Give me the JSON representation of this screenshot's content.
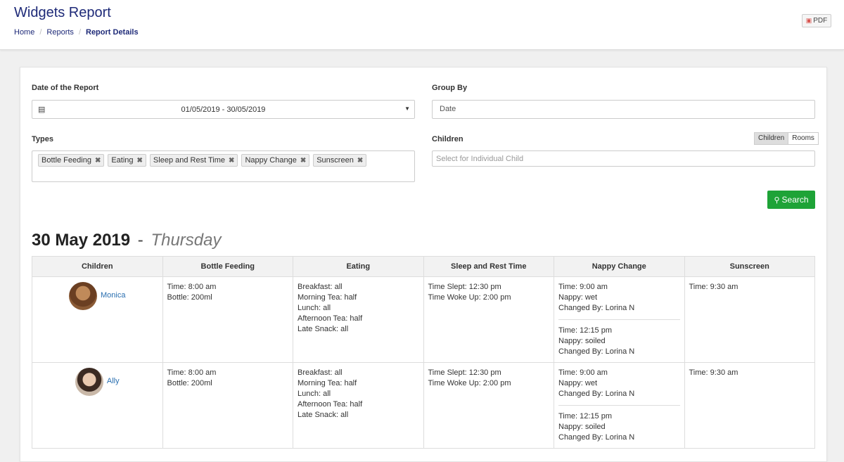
{
  "header": {
    "title": "Widgets Report",
    "breadcrumb": [
      "Home",
      "Reports",
      "Report Details"
    ],
    "pdf_label": "PDF"
  },
  "filters": {
    "date_label": "Date of the Report",
    "date_value": "01/05/2019 - 30/05/2019",
    "group_label": "Group By",
    "group_value": "Date",
    "types_label": "Types",
    "types": [
      "Bottle Feeding",
      "Eating",
      "Sleep and Rest Time",
      "Nappy Change",
      "Sunscreen"
    ],
    "children_label": "Children",
    "toggle": [
      "Children",
      "Rooms"
    ],
    "children_placeholder": "Select for Individual Child",
    "search_label": "Search"
  },
  "report": {
    "date": "30 May 2019",
    "separator": "-",
    "weekday": "Thursday",
    "columns": [
      "Children",
      "Bottle Feeding",
      "Eating",
      "Sleep and Rest Time",
      "Nappy Change",
      "Sunscreen"
    ],
    "rows": [
      {
        "child": "Monica",
        "bottle": [
          "Time: 8:00 am",
          "Bottle: 200ml"
        ],
        "eating": [
          "Breakfast: all",
          "Morning Tea: half",
          "Lunch: all",
          "Afternoon Tea: half",
          "Late Snack: all"
        ],
        "sleep": [
          "Time Slept: 12:30 pm",
          "Time Woke Up: 2:00 pm"
        ],
        "nappy": [
          [
            "Time: 9:00 am",
            "Nappy: wet",
            "Changed By: Lorina N"
          ],
          [
            "Time: 12:15 pm",
            "Nappy: soiled",
            "Changed By: Lorina N"
          ]
        ],
        "sunscreen": [
          "Time: 9:30 am"
        ]
      },
      {
        "child": "Ally",
        "bottle": [
          "Time: 8:00 am",
          "Bottle: 200ml"
        ],
        "eating": [
          "Breakfast: all",
          "Morning Tea: half",
          "Lunch: all",
          "Afternoon Tea: half",
          "Late Snack: all"
        ],
        "sleep": [
          "Time Slept: 12:30 pm",
          "Time Woke Up: 2:00 pm"
        ],
        "nappy": [
          [
            "Time: 9:00 am",
            "Nappy: wet",
            "Changed By: Lorina N"
          ],
          [
            "Time: 12:15 pm",
            "Nappy: soiled",
            "Changed By: Lorina N"
          ]
        ],
        "sunscreen": [
          "Time: 9:30 am"
        ]
      }
    ]
  }
}
